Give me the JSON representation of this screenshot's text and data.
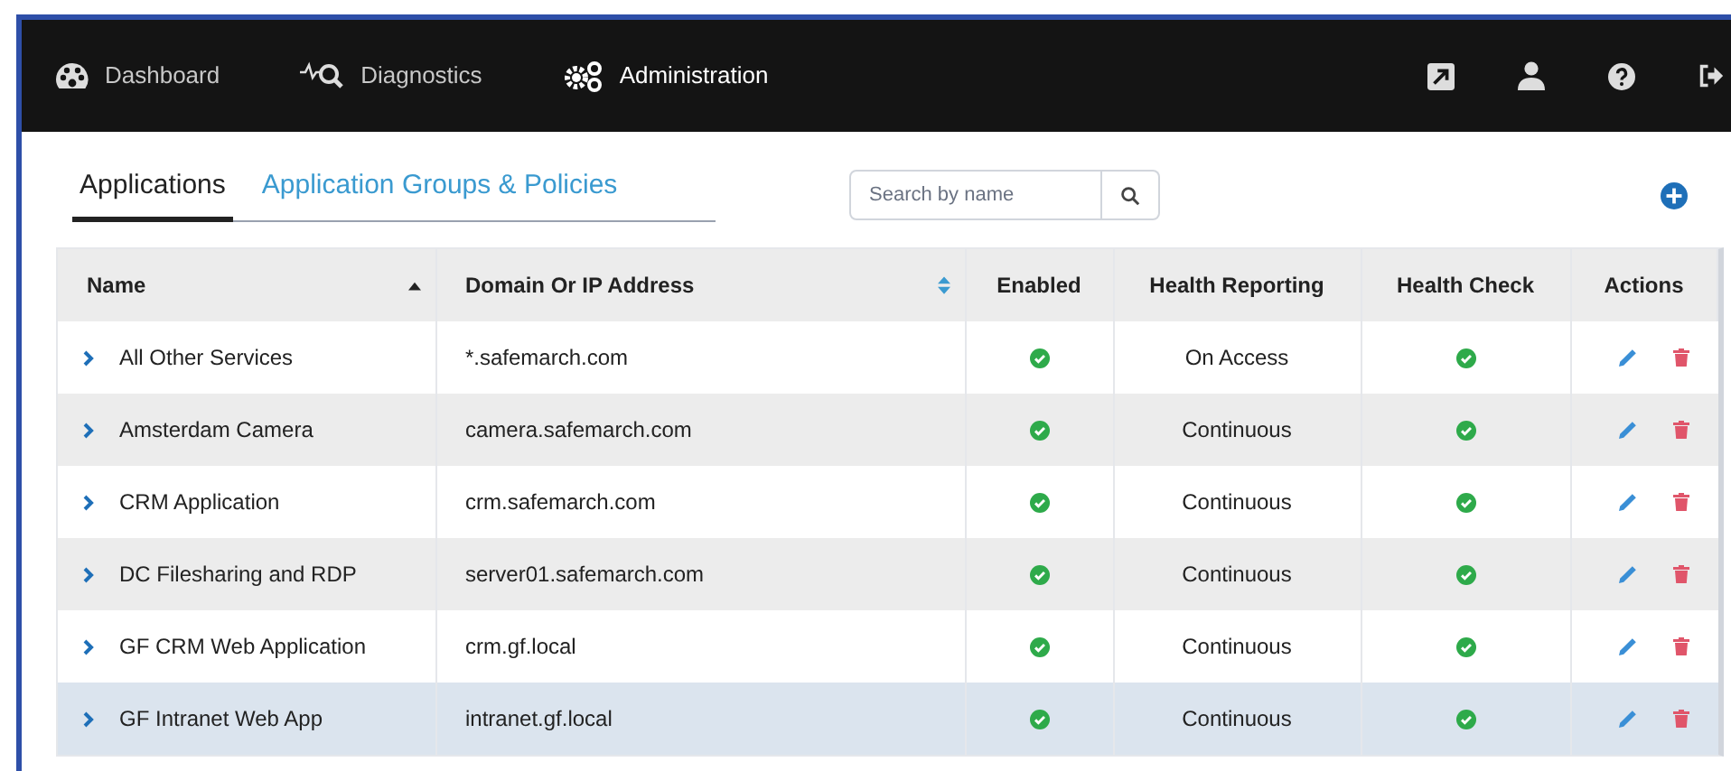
{
  "nav": {
    "items": [
      {
        "label": "Dashboard",
        "kind": "dashboard",
        "selected": false
      },
      {
        "label": "Diagnostics",
        "kind": "diagnostics",
        "selected": false
      },
      {
        "label": "Administration",
        "kind": "administration",
        "selected": true
      }
    ]
  },
  "tabs": [
    {
      "label": "Applications",
      "selected": true
    },
    {
      "label": "Application Groups & Policies",
      "selected": false
    }
  ],
  "search": {
    "placeholder": "Search by name"
  },
  "table": {
    "columns": [
      {
        "label": "Name",
        "sortable": true,
        "sorted": true
      },
      {
        "label": "Domain Or IP Address",
        "sortable": true,
        "sorted": false
      },
      {
        "label": "Enabled",
        "sortable": false,
        "sorted": false
      },
      {
        "label": "Health Reporting",
        "sortable": false,
        "sorted": false
      },
      {
        "label": "Health Check",
        "sortable": false,
        "sorted": false
      },
      {
        "label": "Actions",
        "sortable": false,
        "sorted": false
      }
    ],
    "rows": [
      {
        "name": "All Other Services",
        "domain": "*.safemarch.com",
        "enabled": true,
        "health_reporting": "On Access",
        "health_check": true,
        "selected": false
      },
      {
        "name": "Amsterdam Camera",
        "domain": "camera.safemarch.com",
        "enabled": true,
        "health_reporting": "Continuous",
        "health_check": true,
        "selected": false
      },
      {
        "name": "CRM Application",
        "domain": "crm.safemarch.com",
        "enabled": true,
        "health_reporting": "Continuous",
        "health_check": true,
        "selected": false
      },
      {
        "name": "DC Filesharing and RDP",
        "domain": "server01.safemarch.com",
        "enabled": true,
        "health_reporting": "Continuous",
        "health_check": true,
        "selected": false
      },
      {
        "name": "GF CRM Web Application",
        "domain": "crm.gf.local",
        "enabled": true,
        "health_reporting": "Continuous",
        "health_check": true,
        "selected": false
      },
      {
        "name": "GF Intranet Web App",
        "domain": "intranet.gf.local",
        "enabled": true,
        "health_reporting": "Continuous",
        "health_check": true,
        "selected": true
      }
    ]
  }
}
